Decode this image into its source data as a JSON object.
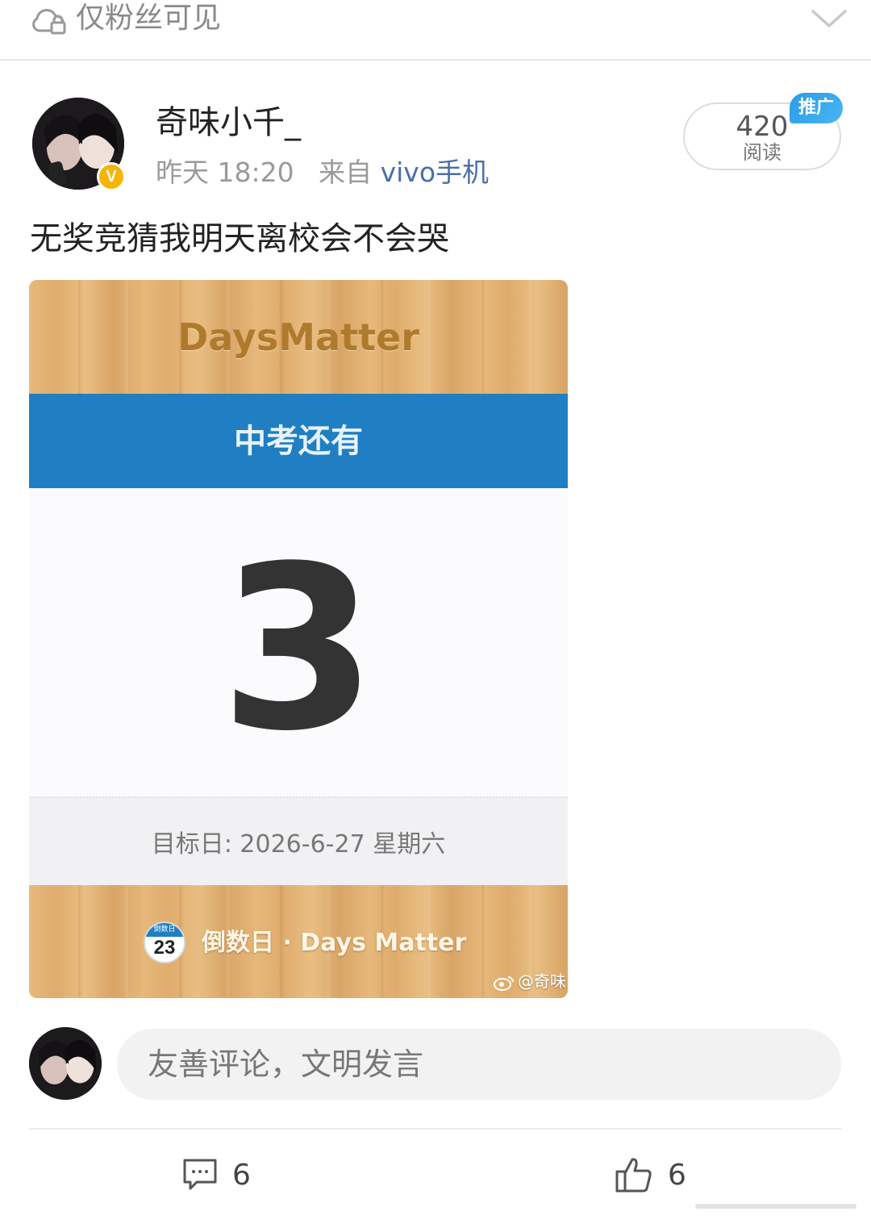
{
  "topbar": {
    "visibility_label": "仅粉丝可见",
    "visibility_icon": "lock-cloud-icon",
    "expand_icon": "chevron-down-icon"
  },
  "post": {
    "username": "奇味小千_",
    "time": "昨天 18:20",
    "source_prefix": "来自",
    "device": "vivo手机",
    "verified_badge": "V",
    "reads_count": "420",
    "reads_label": "阅读",
    "promo_label": "推广",
    "text": "无奖竞猜我明天离校会不会哭"
  },
  "image_card": {
    "app_title": "DaysMatter",
    "event_label": "中考还有",
    "days_count": "3",
    "target_date": "目标日: 2026-6-27 星期六",
    "calendar_icon_header": "倒数日",
    "calendar_icon_number": "23",
    "brand_footer": "倒数日 · Days Matter",
    "watermark": "@奇味",
    "colors": {
      "band_blue": "#1f7fc2",
      "wood": "#e3b376"
    }
  },
  "comment": {
    "placeholder": "友善评论，文明发言"
  },
  "actions": {
    "comments_count": "6",
    "likes_count": "6"
  },
  "colors": {
    "accent_link": "#4a6ea8",
    "badge_gold": "#f5b400",
    "promo_blue": "#2a9be6"
  }
}
